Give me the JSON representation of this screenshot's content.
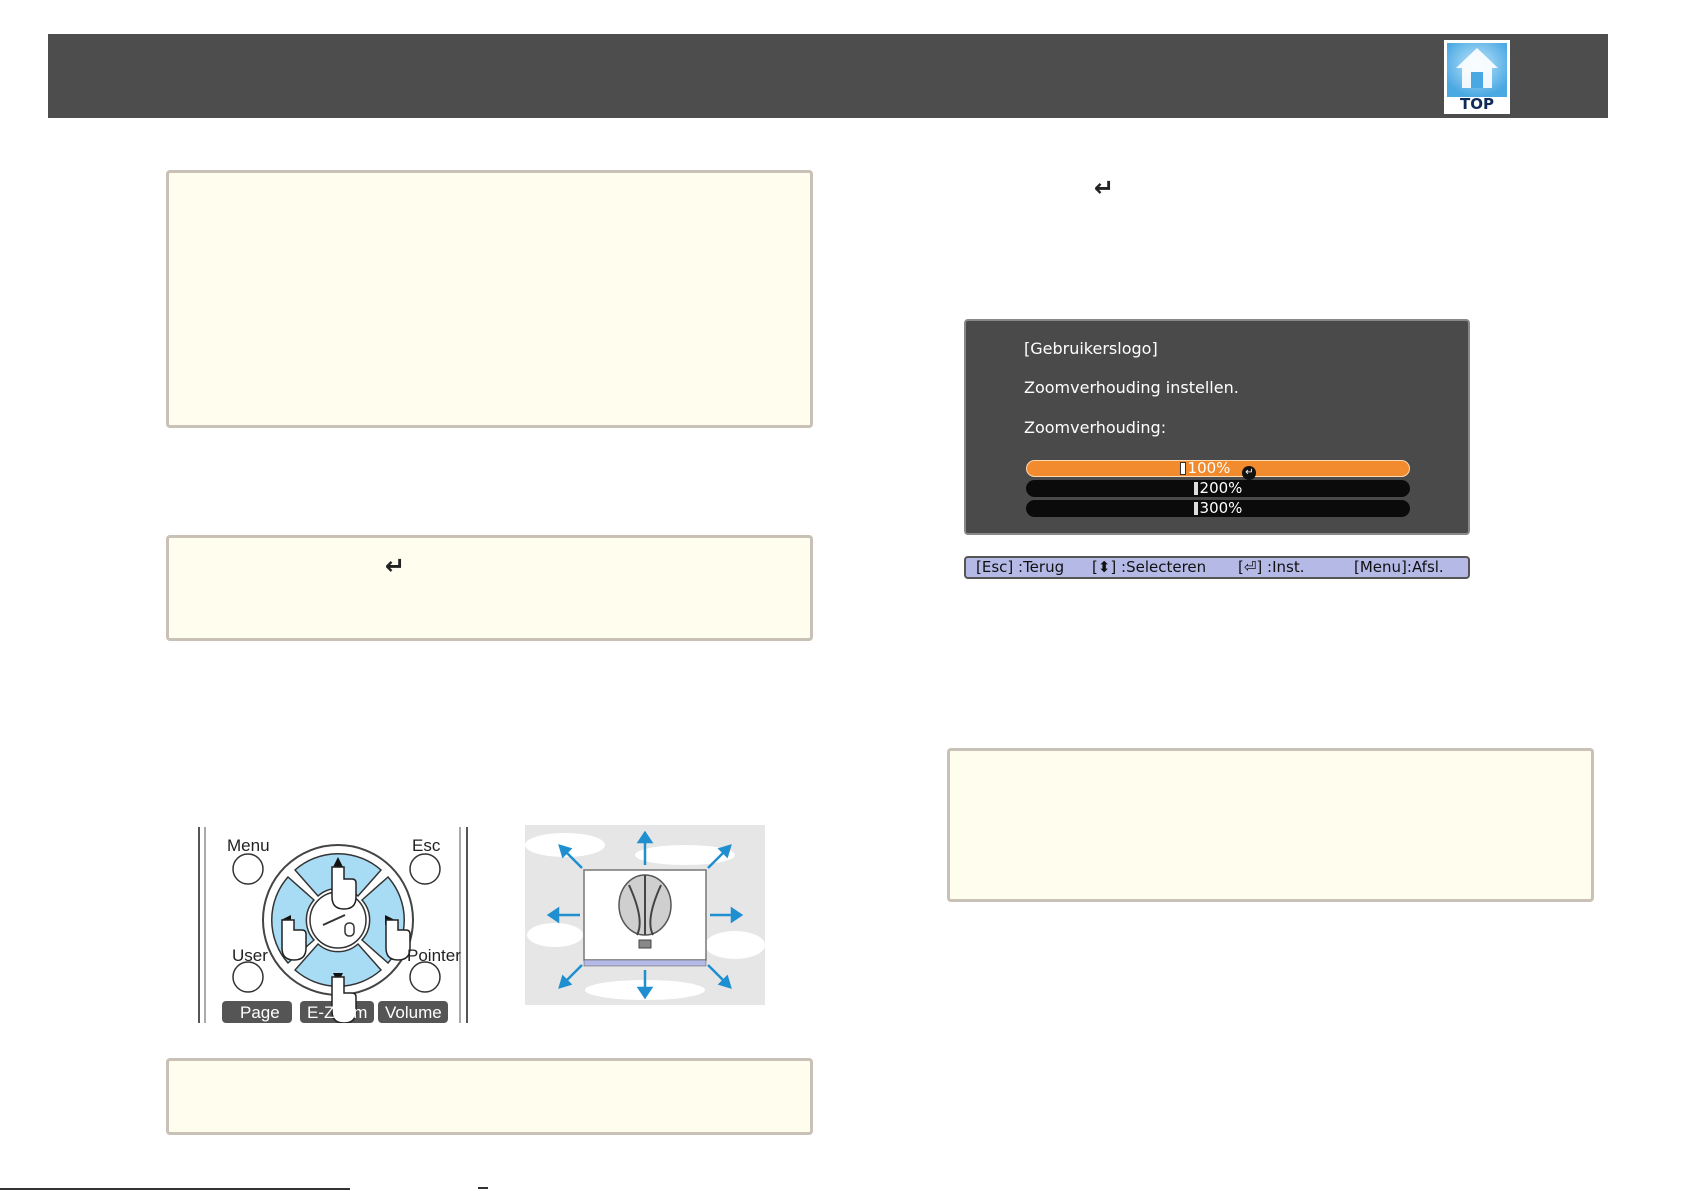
{
  "header": {
    "top_button_label": "TOP"
  },
  "notes": {
    "note_2_enter_icon": "enter-icon"
  },
  "right_column": {
    "enter_icon": "enter-icon"
  },
  "remote": {
    "labels": {
      "menu": "Menu",
      "esc": "Esc",
      "user": "User",
      "pointer": "Pointer",
      "page": "Page",
      "ezoom": "E-Zoom",
      "volume": "Volume"
    }
  },
  "osd": {
    "title": "[Gebruikerslogo]",
    "instruction": "Zoomverhouding instellen.",
    "label": "Zoomverhouding:",
    "options": [
      {
        "label": "100%",
        "selected": true
      },
      {
        "label": "200%",
        "selected": false
      },
      {
        "label": "300%",
        "selected": false
      }
    ],
    "guide": {
      "esc": "[Esc] :Terug",
      "select": "[⬍] :Selecteren",
      "enter": "[⏎] :Inst.",
      "menu": "[Menu]:Afsl."
    }
  },
  "colors": {
    "header": "#4d4d4d",
    "note_background": "#fffdee",
    "note_border": "#c9c1b5",
    "osd_background": "#4a4a4a",
    "osd_selected": "#f28a2e",
    "osd_guide": "#b5b9e6",
    "remote_highlight": "#a8dcf5",
    "arrow": "#1f8fd0"
  }
}
